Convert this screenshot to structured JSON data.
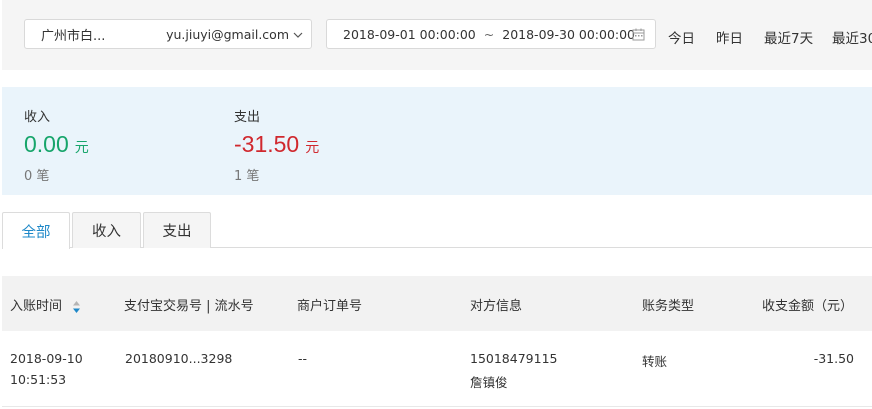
{
  "filters": {
    "account_name": "广州市白...",
    "account_email": "yu.jiuyi@gmail.com",
    "date_start": "2018-09-01 00:00:00",
    "date_separator": "~",
    "date_end": "2018-09-30 00:00:00",
    "quick_ranges": [
      "今日",
      "昨日",
      "最近7天",
      "最近30"
    ]
  },
  "summary": {
    "income": {
      "label": "收入",
      "amount": "0.00",
      "unit": "元",
      "count": "0 笔",
      "color": "#17a56b"
    },
    "expense": {
      "label": "支出",
      "amount": "-31.50",
      "unit": "元",
      "count": "1 笔",
      "color": "#d0282e"
    }
  },
  "tabs": [
    {
      "label": "全部",
      "active": true
    },
    {
      "label": "收入",
      "active": false
    },
    {
      "label": "支出",
      "active": false
    }
  ],
  "table": {
    "columns": [
      "入账时间",
      "支付宝交易号 | 流水号",
      "商户订单号",
      "对方信息",
      "账务类型",
      "收支金额（元）"
    ],
    "rows": [
      {
        "date": "2018-09-10",
        "time": "10:51:53",
        "trade_no": "20180910...3298",
        "merchant_order": "--",
        "counterparty_account": "15018479115",
        "counterparty_name": "詹镇俊",
        "type": "转账",
        "amount": "-31.50"
      }
    ]
  },
  "colors": {
    "accent": "#1e88c8",
    "summary_bg": "#eaf4fb"
  }
}
